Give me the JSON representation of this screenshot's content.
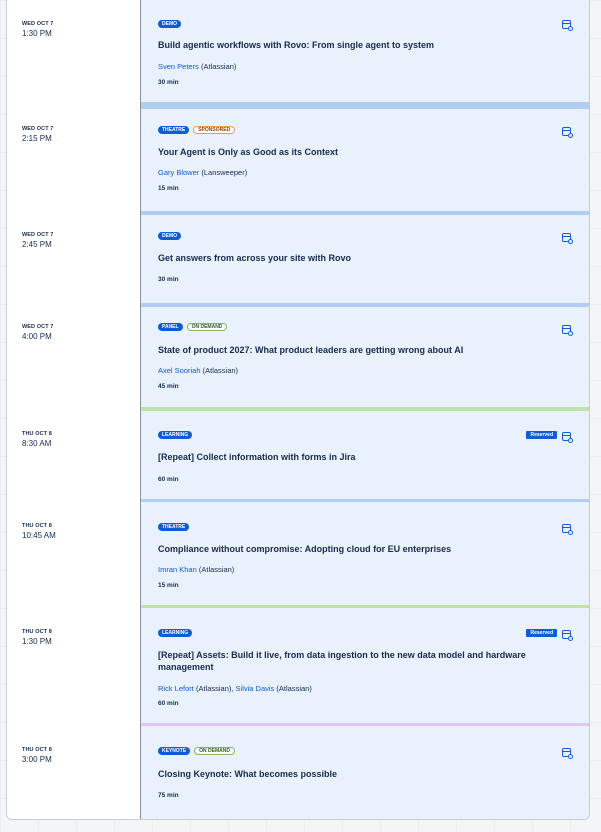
{
  "colors": {
    "accent": "#0c5dd6",
    "card_background": "#e9f1fd",
    "strip_blue": "#b3ccf2",
    "strip_green": "#bfe3a6",
    "strip_purple": "#dcc8f2"
  },
  "sessions": [
    {
      "day": "WED OCT 7",
      "time": "1:30 PM",
      "badges": [
        "DEMO"
      ],
      "title": "Build agentic workflows with Rovo: From single agent to system",
      "speaker_name": "Sven Peters",
      "speaker_org": " (Atlassian)",
      "duration": "30 min"
    },
    {
      "day": "WED OCT 7",
      "time": "2:15 PM",
      "badges": [
        "THEATRE",
        "SPONSORED"
      ],
      "title": "Your Agent is Only as Good as its Context",
      "speaker_name": "Gary Blower",
      "speaker_org": " (Lansweeper)",
      "duration": "15 min"
    },
    {
      "day": "WED OCT 7",
      "time": "2:45 PM",
      "badges": [
        "DEMO"
      ],
      "title": "Get answers from across your site with Rovo",
      "duration": "30 min"
    },
    {
      "day": "WED OCT 7",
      "time": "4:00 PM",
      "badges": [
        "PANEL",
        "ON DEMAND"
      ],
      "title": "State of product 2027: What product leaders are getting wrong about AI",
      "speaker_name": "Axel Sooriah",
      "speaker_org": " (Atlassian)",
      "duration": "45 min"
    },
    {
      "day": "THU OCT 8",
      "time": "8:30 AM",
      "badges": [
        "LEARNING"
      ],
      "reserved": "Reserved",
      "title": "[Repeat] Collect information with forms in Jira",
      "duration": "60 min"
    },
    {
      "day": "THU OCT 8",
      "time": "10:45 AM",
      "badges": [
        "THEATRE"
      ],
      "title": "Compliance without compromise: Adopting cloud for EU enterprises",
      "speaker_name": "Imran Khan",
      "speaker_org": " (Atlassian)",
      "duration": "15 min"
    },
    {
      "day": "THU OCT 8",
      "time": "1:30 PM",
      "badges": [
        "LEARNING"
      ],
      "reserved": "Reserved",
      "title": "[Repeat] Assets: Build it live, from data ingestion to the new data model and hardware management",
      "speaker_name": "Rick Lefort",
      "speaker_org": " (Atlassian), ",
      "speaker2_name": "Silvia Davis",
      "speaker2_org": " (Atlassian)",
      "duration": "60 min"
    },
    {
      "day": "THU OCT 8",
      "time": "3:00 PM",
      "badges": [
        "KEYNOTE",
        "ON DEMAND"
      ],
      "title": "Closing Keynote: What becomes possible",
      "duration": "75 min"
    }
  ]
}
